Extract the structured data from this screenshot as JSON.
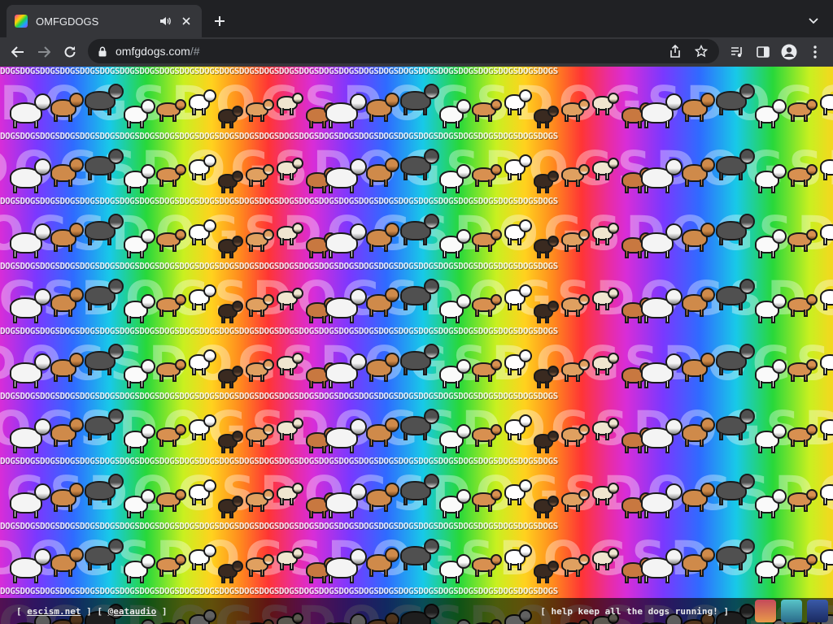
{
  "tab": {
    "title": "OMFGDOGS",
    "audio_icon": "speaker-icon",
    "close_icon": "close-icon"
  },
  "toolbar": {
    "url_host": "omfgdogs.com",
    "url_hash": "/#"
  },
  "page": {
    "dogs_text": "DOGSDOGSDOGSDOGSDOGSDOGSDOGSDOGSDOGSDOGSDOGSDOGSDOGSDOGSDOGSDOGSDOGSDOGSDOGSDOGSDOGSDOGSDOGSDOGSDOGSDOGSDOGSDOGS",
    "big_letters": "DOGSDOGSDOGSDOGSDOGSDOGSDOGSDOGS"
  },
  "footer": {
    "bracket_open_1": "[",
    "link_1": "escism.net",
    "sep": "] [",
    "link_2": "@eataudio",
    "bracket_close_2": "]",
    "right_text": "[ help keep all the dogs running! ]"
  },
  "colors": {
    "chrome_bg": "#202124",
    "tab_bg": "#35363a",
    "text": "#e8eaed"
  }
}
